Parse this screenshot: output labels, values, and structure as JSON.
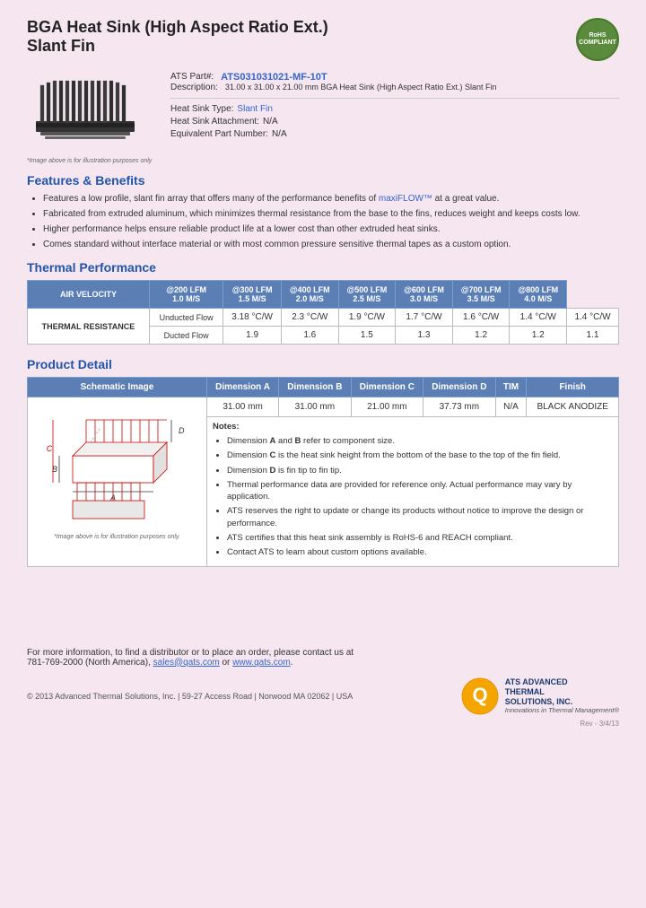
{
  "page": {
    "title_line1": "BGA Heat Sink (High Aspect Ratio Ext.)",
    "title_line2": "Slant Fin",
    "rohs": "RoHS\nCOMPLIANT",
    "part_label": "ATS Part#:",
    "part_number": "ATS031031021-MF-10T",
    "desc_label": "Description:",
    "description": "31.00 x 31.00 x 21.00 mm BGA Heat Sink (High Aspect Ratio Ext.) Slant Fin",
    "heat_sink_type_label": "Heat Sink Type:",
    "heat_sink_type": "Slant Fin",
    "heat_sink_attachment_label": "Heat Sink Attachment:",
    "heat_sink_attachment": "N/A",
    "equivalent_part_label": "Equivalent Part Number:",
    "equivalent_part": "N/A",
    "image_caption": "*Image above is for illustration purposes only",
    "features_title": "Features & Benefits",
    "features": [
      "Features a low profile, slant fin array that offers many of the performance benefits of maxiFLOW™ at a great value.",
      "Fabricated from extruded aluminum, which minimizes thermal resistance from the base to the fins, reduces weight and keeps costs low.",
      "Higher performance helps ensure reliable product life at a lower cost than other extruded heat sinks.",
      "Comes standard without interface material or with most common pressure sensitive thermal tapes as a custom option."
    ],
    "maxiflow_link": "maxiFLOW™",
    "thermal_title": "Thermal Performance",
    "thermal_table": {
      "header_row1": [
        "AIR VELOCITY",
        "@200 LFM\n1.0 M/S",
        "@300 LFM\n1.5 M/S",
        "@400 LFM\n2.0 M/S",
        "@500 LFM\n2.5 M/S",
        "@600 LFM\n3.0 M/S",
        "@700 LFM\n3.5 M/S",
        "@800 LFM\n4.0 M/S"
      ],
      "category": "THERMAL RESISTANCE",
      "row_unducted_label": "Unducted Flow",
      "row_ducted_label": "Ducted Flow",
      "unducted": [
        "3.18 °C/W",
        "2.3 °C/W",
        "1.9 °C/W",
        "1.7 °C/W",
        "1.6 °C/W",
        "1.4 °C/W",
        "1.4 °C/W"
      ],
      "ducted": [
        "1.9",
        "1.6",
        "1.5",
        "1.3",
        "1.2",
        "1.2",
        "1.1"
      ]
    },
    "product_detail_title": "Product Detail",
    "detail_table": {
      "headers": [
        "Schematic Image",
        "Dimension A",
        "Dimension B",
        "Dimension C",
        "Dimension D",
        "TIM",
        "Finish"
      ],
      "dim_a": "31.00 mm",
      "dim_b": "31.00 mm",
      "dim_c": "21.00 mm",
      "dim_d": "37.73 mm",
      "tim": "N/A",
      "finish": "BLACK ANODIZE"
    },
    "notes_title": "Notes:",
    "notes": [
      "Dimension <b>A</b> and <b>B</b> refer to component size.",
      "Dimension <b>C</b> is the heat sink height from the bottom of the base to the top of the fin field.",
      "Dimension <b>D</b> is fin tip to fin tip.",
      "Thermal performance data are provided for reference only. Actual performance may vary by application.",
      "ATS reserves the right to update or change its products without notice to improve the design or performance.",
      "ATS certifies that this heat sink assembly is RoHS-6 and REACH compliant.",
      "Contact ATS to learn about custom options available."
    ],
    "schematic_caption": "*Image above is for illustration purposes only.",
    "footer_contact": "For more information, to find a distributor or to place an order, please contact us at",
    "footer_phone": "781-769-2000 (North America),",
    "footer_email": "sales@qats.com",
    "footer_or": "or",
    "footer_website": "www.qats.com",
    "footer_copyright": "© 2013 Advanced Thermal Solutions, Inc.",
    "footer_address": "59-27 Access Road  |  Norwood MA  02062  |  USA",
    "ats_name": "ADVANCED\nTHERMAL\nSOLUTIONS, INC.",
    "ats_tagline": "Innovations in Thermal Management®",
    "rev": "Rev - 3/4/13"
  }
}
